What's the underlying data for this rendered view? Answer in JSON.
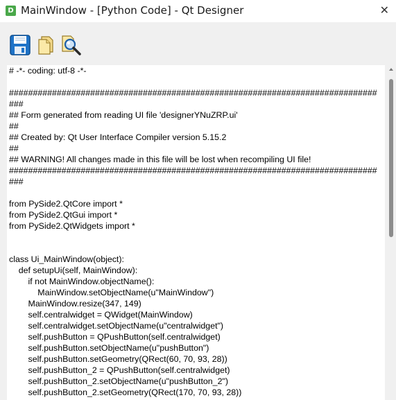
{
  "window": {
    "title": "MainWindow - [Python Code] - Qt Designer",
    "app_icon_letter": "D",
    "close_glyph": "✕"
  },
  "toolbar": {
    "buttons": [
      {
        "icon": "save-icon"
      },
      {
        "icon": "copy-icon"
      },
      {
        "icon": "find-icon"
      }
    ]
  },
  "code": {
    "lines": [
      "# -*- coding: utf-8 -*-",
      "",
      "################################################################################",
      "## Form generated from reading UI file 'designerYNuZRP.ui'",
      "##",
      "## Created by: Qt User Interface Compiler version 5.15.2",
      "##",
      "## WARNING! All changes made in this file will be lost when recompiling UI file!",
      "################################################################################",
      "",
      "from PySide2.QtCore import *",
      "from PySide2.QtGui import *",
      "from PySide2.QtWidgets import *",
      "",
      "",
      "class Ui_MainWindow(object):",
      "    def setupUi(self, MainWindow):",
      "        if not MainWindow.objectName():",
      "            MainWindow.setObjectName(u\"MainWindow\")",
      "        MainWindow.resize(347, 149)",
      "        self.centralwidget = QWidget(MainWindow)",
      "        self.centralwidget.setObjectName(u\"centralwidget\")",
      "        self.pushButton = QPushButton(self.centralwidget)",
      "        self.pushButton.setObjectName(u\"pushButton\")",
      "        self.pushButton.setGeometry(QRect(60, 70, 93, 28))",
      "        self.pushButton_2 = QPushButton(self.centralwidget)",
      "        self.pushButton_2.setObjectName(u\"pushButton_2\")",
      "        self.pushButton_2.setGeometry(QRect(170, 70, 93, 28))"
    ]
  }
}
